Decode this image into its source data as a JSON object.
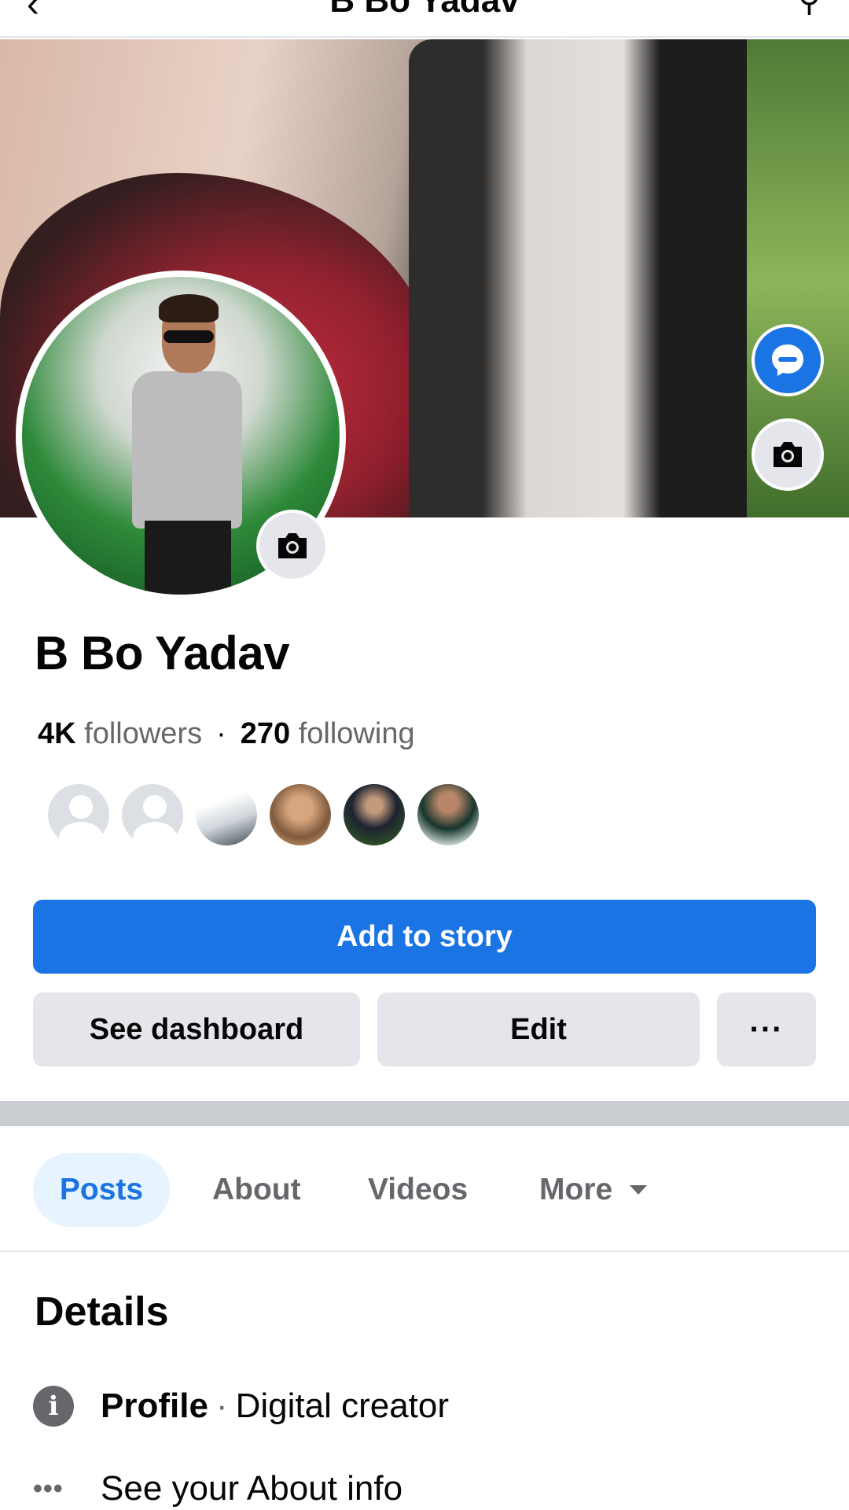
{
  "topbar": {
    "back_icon": "back-arrow-icon",
    "title": "B Bo Yadav",
    "search_icon": "search-icon"
  },
  "profile": {
    "name": "B Bo Yadav",
    "followers_count": "4K",
    "followers_label": "followers",
    "following_count": "270",
    "following_label": "following",
    "separator": "·"
  },
  "actions": {
    "add_story": "Add to story",
    "dashboard": "See dashboard",
    "edit": "Edit",
    "more": "···"
  },
  "tabs": [
    {
      "label": "Posts",
      "active": true
    },
    {
      "label": "About"
    },
    {
      "label": "Videos"
    },
    {
      "label": "More"
    }
  ],
  "details": {
    "title": "Details",
    "row1_label": "Profile",
    "row1_sep": "·",
    "row1_value": "Digital creator",
    "row2_text": "See your About info",
    "row1_icon": "info-icon",
    "row2_icon": "more-dots-icon"
  },
  "colors": {
    "accent": "#1b74e4",
    "secondary_bg": "#e4e6eb",
    "muted_text": "#65676b",
    "active_tab_bg": "#e7f3ff"
  }
}
